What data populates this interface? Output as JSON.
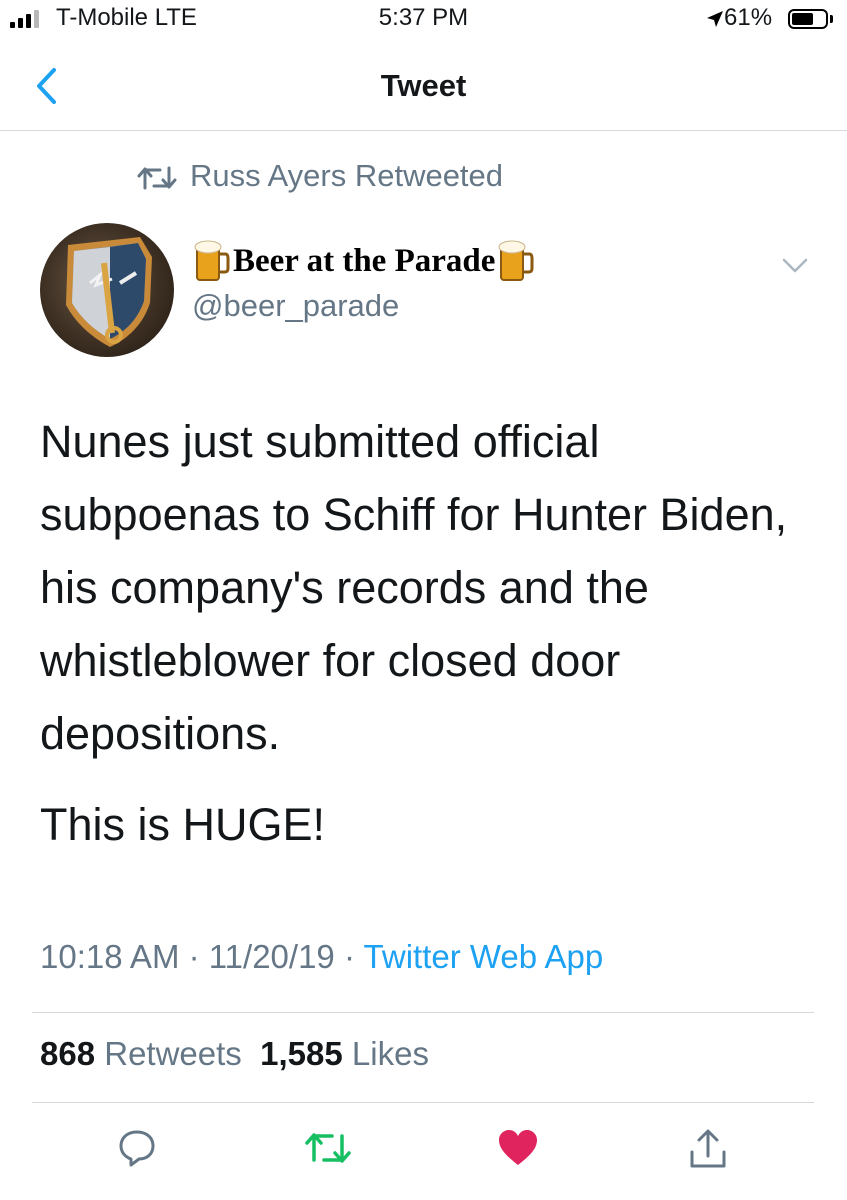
{
  "status_bar": {
    "carrier": "T-Mobile  LTE",
    "time": "5:37 PM",
    "battery": "61%",
    "battery_level": 0.61
  },
  "nav": {
    "title": "Tweet",
    "back_icon": "chevron-left-icon"
  },
  "tweet": {
    "retweeted_by": "Russ Ayers Retweeted",
    "display_name": "Beer at the Parade",
    "handle": "@beer_parade",
    "text": "Nunes just submitted official subpoenas to Schiff for Hunter Biden, his company's records and the whistleblower for closed door depositions.",
    "text2": "This is HUGE!",
    "time": "10:18 AM",
    "date": "11/20/19",
    "source": "Twitter Web App",
    "retweet_count": "868",
    "retweets_label": "Retweets",
    "like_count": "1,585",
    "likes_label": "Likes"
  },
  "colors": {
    "accent": "#1da1f2",
    "muted": "#657786",
    "retweet": "#17bf63",
    "like": "#e0245e"
  },
  "actions": [
    "reply-icon",
    "retweet-icon",
    "like-icon",
    "share-icon"
  ]
}
